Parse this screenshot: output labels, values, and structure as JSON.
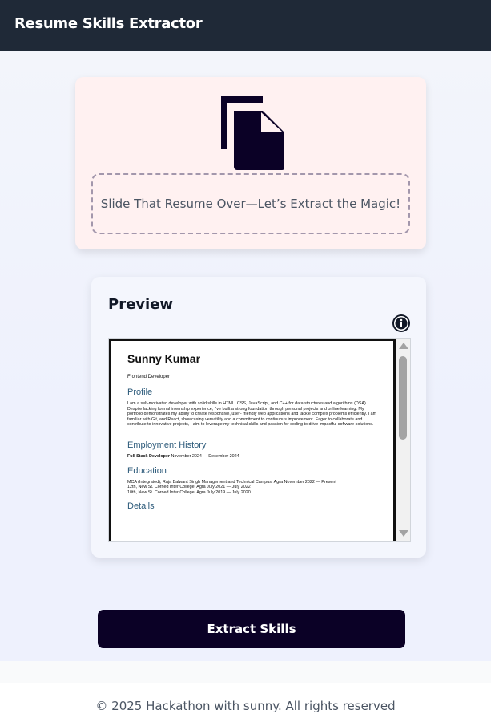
{
  "header": {
    "title": "Resume Skills Extractor"
  },
  "upload": {
    "icon": "documents-copy-icon",
    "dropzone_text": "Slide That Resume Over—Let’s Extract the Magic!"
  },
  "preview": {
    "title": "Preview",
    "info_icon": "info-icon",
    "document": {
      "name": "Sunny Kumar",
      "role": "Frontend Developer",
      "profile_heading": "Profile",
      "profile_text": "I am a self-motivated developer with solid skills in HTML, CSS, JavaScript, and C++ for data structures and algorithms (DSA). Despite lacking formal internship experience, I've built a strong foundation through personal projects and online learning. My portfolio demonstrates my ability to create responsive, user- friendly web applications and tackle complex problems efficiently. I am familiar with Git, and React, showcasing versatility and a commitment to continuous improvement. Eager to collaborate and contribute to innovative projects, I aim to leverage my technical skills and passion for coding to drive impactful software solutions.",
      "employment_heading": "Employment History",
      "employment_role": "Full Stack Developer",
      "employment_dates": "November 2024 — December 2024",
      "education_heading": "Education",
      "education_lines": [
        "MCA (Integrated), Raja Balwant Singh Management and Technical Campus, Agra November 2022 — Present",
        "12th, New St. Corned Inter College, Agra July 2021 — July 2022",
        "10th, New St. Corned Inter College, Agra July 2019 — July 2020"
      ],
      "details_heading": "Details"
    }
  },
  "actions": {
    "extract_label": "Extract Skills"
  },
  "footer": {
    "text": "© 2025 Hackathon with sunny. All rights reserved"
  },
  "colors": {
    "header_bg": "#1f2937",
    "upload_card_bg": "#fff1f1",
    "button_bg": "#0b0126",
    "doc_heading": "#2c5a7a"
  }
}
